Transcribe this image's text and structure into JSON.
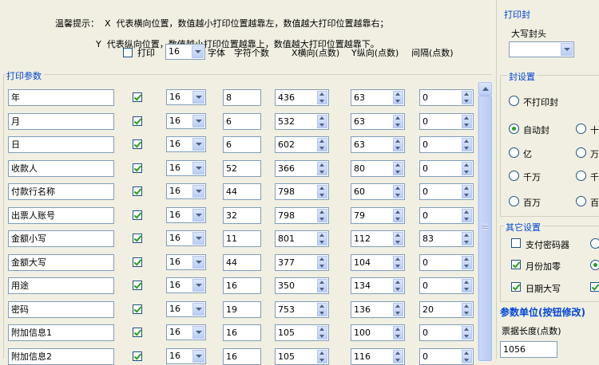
{
  "tip": {
    "line1": "温馨提示：  X  代表横向位置，数值越小打印位置越靠左，数值越大打印位置越靠右；",
    "line2": "Y  代表纵向位置，数值越小打印位置越靠上，数值越大打印位置越靠下。"
  },
  "header": {
    "print_label": "打印",
    "font_value": "16",
    "font_label": "字体",
    "chars_label": "字符个数",
    "x_label": "X横向(点数)",
    "y_label": "Y纵向(点数)",
    "gap_label": "间隔(点数)"
  },
  "params_title": "打印参数",
  "rows": [
    {
      "name": "年",
      "checked": true,
      "font": "16",
      "chars": "8",
      "x": "436",
      "y": "63",
      "gap": "0"
    },
    {
      "name": "月",
      "checked": true,
      "font": "16",
      "chars": "6",
      "x": "532",
      "y": "63",
      "gap": "0"
    },
    {
      "name": "日",
      "checked": true,
      "font": "16",
      "chars": "6",
      "x": "602",
      "y": "63",
      "gap": "0"
    },
    {
      "name": "收款人",
      "checked": true,
      "font": "16",
      "chars": "52",
      "x": "366",
      "y": "80",
      "gap": "0"
    },
    {
      "name": "付款行名称",
      "checked": true,
      "font": "16",
      "chars": "44",
      "x": "798",
      "y": "60",
      "gap": "0"
    },
    {
      "name": "出票人账号",
      "checked": true,
      "font": "16",
      "chars": "32",
      "x": "798",
      "y": "79",
      "gap": "0"
    },
    {
      "name": "金额小写",
      "checked": true,
      "font": "16",
      "chars": "11",
      "x": "801",
      "y": "112",
      "gap": "83"
    },
    {
      "name": "金额大写",
      "checked": true,
      "font": "16",
      "chars": "44",
      "x": "377",
      "y": "104",
      "gap": "0"
    },
    {
      "name": "用途",
      "checked": true,
      "font": "16",
      "chars": "16",
      "x": "350",
      "y": "134",
      "gap": "0"
    },
    {
      "name": "密码",
      "checked": true,
      "font": "16",
      "chars": "19",
      "x": "753",
      "y": "136",
      "gap": "20"
    },
    {
      "name": "附加信息1",
      "checked": true,
      "font": "16",
      "chars": "16",
      "x": "105",
      "y": "100",
      "gap": "0"
    },
    {
      "name": "附加信息2",
      "checked": true,
      "font": "16",
      "chars": "16",
      "x": "105",
      "y": "116",
      "gap": "0"
    }
  ],
  "right": {
    "seal_title": "打印封",
    "seal_label": "大写封头",
    "seal_settings_title": "封设置",
    "no_print_seal": "不打印封",
    "auto_seal": "自动封",
    "ten": "十",
    "yi": "亿",
    "wan": "万",
    "qianwan": "千万",
    "qian": "千",
    "baiwan": "百万",
    "bai": "百",
    "other_title": "其它设置",
    "pay_pwd": "支付密码器",
    "month_zero": "月份加零",
    "date_upper": "日期大写",
    "unit_title": "参数单位(按钮修改)",
    "bill_length_label": "票据长度(点数)",
    "bill_length_value": "1056"
  },
  "colors": {
    "check": "#21a121",
    "group_title": "#0046d5",
    "background": "#f1efe2"
  }
}
